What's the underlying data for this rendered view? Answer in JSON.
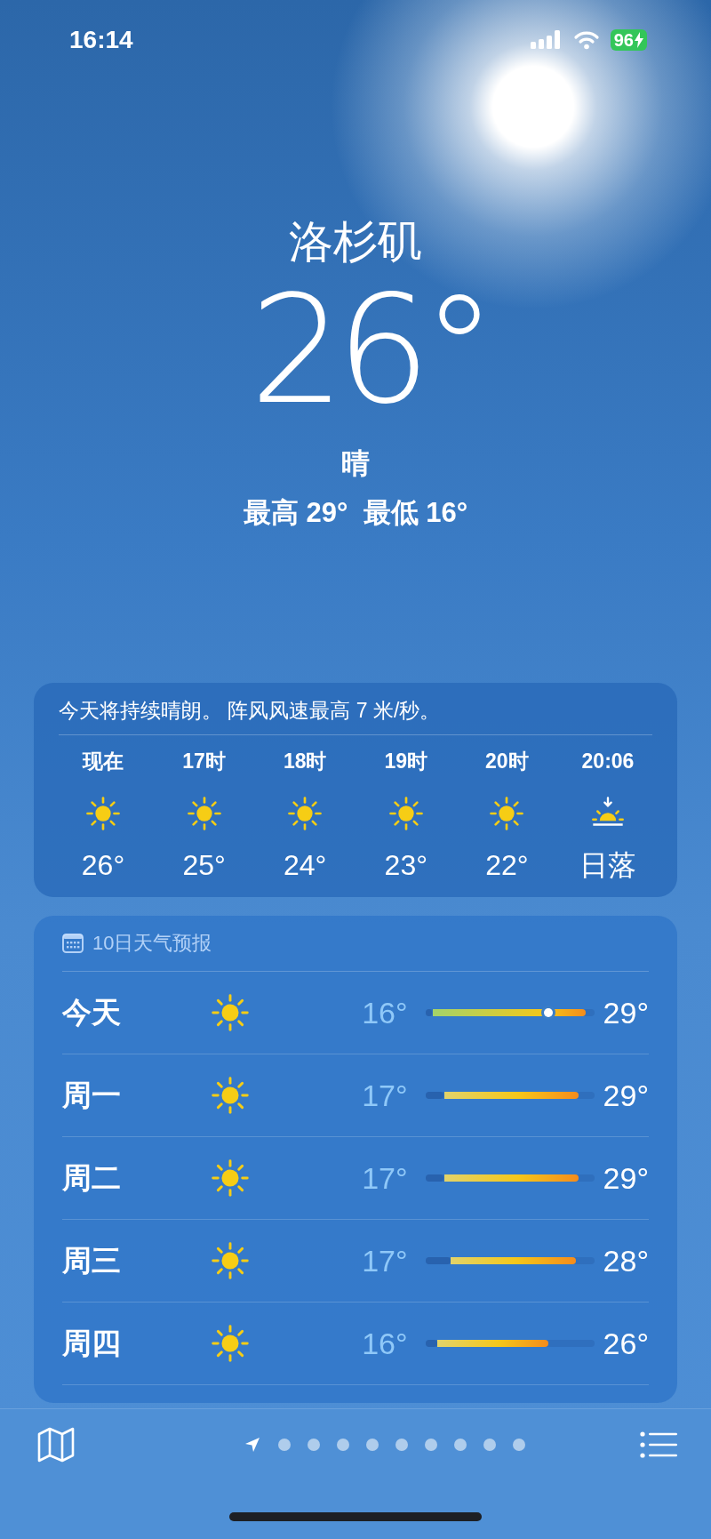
{
  "status_bar": {
    "time": "16:14",
    "battery": {
      "text": "96",
      "charging": true
    }
  },
  "location": {
    "city": "洛杉矶",
    "temperature": "26°",
    "condition": "晴",
    "high_low": "最高 29°  最低 16°"
  },
  "hourly": {
    "summary": "今天将持续晴朗。 阵风风速最高 7 米/秒。",
    "items": [
      {
        "label": "现在",
        "kind": "sun",
        "value": "26°"
      },
      {
        "label": "17时",
        "kind": "sun",
        "value": "25°"
      },
      {
        "label": "18时",
        "kind": "sun",
        "value": "24°"
      },
      {
        "label": "19时",
        "kind": "sun",
        "value": "23°"
      },
      {
        "label": "20时",
        "kind": "sun",
        "value": "22°"
      },
      {
        "label": "20:06",
        "kind": "sunset",
        "value": "日落"
      }
    ]
  },
  "daily": {
    "title": "10日天气预报",
    "rows": [
      {
        "day": "今天",
        "kind": "sun",
        "low": "16°",
        "high": "29°",
        "start": {
          "level": 0.04
        },
        "end": {
          "level": 0.95
        },
        "current": {
          "level": 0.73
        }
      },
      {
        "day": "周一",
        "kind": "sun",
        "low": "17°",
        "high": "29°",
        "start": {
          "level": 0.11
        },
        "end": {
          "level": 0.91
        }
      },
      {
        "day": "周二",
        "kind": "sun",
        "low": "17°",
        "high": "29°",
        "start": {
          "level": 0.11
        },
        "end": {
          "level": 0.91
        }
      },
      {
        "day": "周三",
        "kind": "sun",
        "low": "17°",
        "high": "28°",
        "start": {
          "level": 0.15
        },
        "end": {
          "level": 0.89
        }
      },
      {
        "day": "周四",
        "kind": "sun",
        "low": "16°",
        "high": "26°",
        "start": {
          "level": 0.07
        },
        "end": {
          "level": 0.73
        }
      }
    ]
  },
  "pages": [
    {
      "kind": "location",
      "selected": true
    },
    {
      "kind": "dot",
      "selected": false
    },
    {
      "kind": "dot",
      "selected": false
    },
    {
      "kind": "dot",
      "selected": false
    },
    {
      "kind": "dot",
      "selected": false
    },
    {
      "kind": "dot",
      "selected": false
    },
    {
      "kind": "dot",
      "selected": false
    },
    {
      "kind": "dot",
      "selected": false
    },
    {
      "kind": "dot",
      "selected": false
    },
    {
      "kind": "dot",
      "selected": false
    }
  ]
}
